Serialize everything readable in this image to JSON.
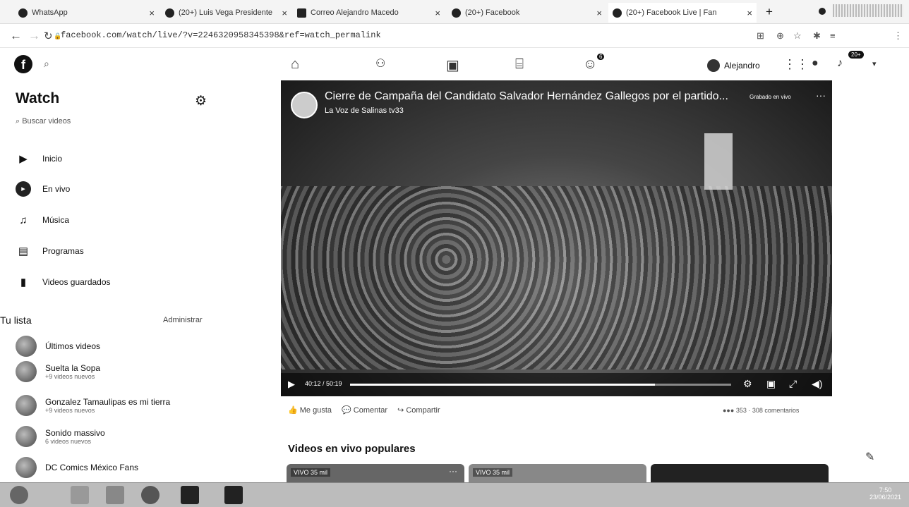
{
  "tabs": [
    {
      "title": "WhatsApp",
      "close": "×"
    },
    {
      "title": "(20+) Luis Vega Presidente",
      "close": "×"
    },
    {
      "title": "Correo Alejandro Macedo",
      "close": "×"
    },
    {
      "title": "(20+) Facebook",
      "close": "×"
    },
    {
      "title": "(20+) Facebook Live | Fan",
      "close": "×"
    }
  ],
  "new_tab": "+",
  "address": {
    "url": "facebook.com/watch/live/?v=2246320958345398&ref=watch_permalink"
  },
  "topnav": {
    "user": "Alejandro",
    "notif_count": "20+",
    "gaming_badge": "6"
  },
  "sidebar": {
    "title": "Watch",
    "search_placeholder": "Buscar videos",
    "items": [
      {
        "label": "Inicio"
      },
      {
        "label": "En vivo"
      },
      {
        "label": "Música"
      },
      {
        "label": "Programas"
      },
      {
        "label": "Videos guardados"
      }
    ],
    "list_title": "Tu lista",
    "manage": "Administrar",
    "list": [
      {
        "name": "Últimos videos",
        "sub": ""
      },
      {
        "name": "Suelta la Sopa",
        "sub": "+9 videos nuevos"
      },
      {
        "name": "Gonzalez Tamaulipas es mi tierra",
        "sub": "+9 videos nuevos"
      },
      {
        "name": "Sonido massivo",
        "sub": "6 videos nuevos"
      },
      {
        "name": "DC Comics México Fans",
        "sub": ""
      }
    ]
  },
  "video": {
    "title": "Cierre de Campaña del Candidato Salvador Hernández Gallegos por el partido...",
    "channel": "La Voz de Salinas tv33",
    "recorded": "Grabado en vivo",
    "more": "···",
    "time": "40:12 / 50:19",
    "progress": 0.8
  },
  "actions": {
    "like": "Me gusta",
    "comment": "Comentar",
    "share": "Compartir"
  },
  "reactions": {
    "summary": "353 · 308 comentarios"
  },
  "popular": {
    "title": "Videos en vivo populares",
    "cards": [
      {
        "badge": "VIVO  35 mil",
        "more": "···"
      },
      {
        "badge": "VIVO  35 mil",
        "more": ""
      },
      {
        "badge": "",
        "more": ""
      }
    ]
  },
  "taskbar": {
    "time": "7:50",
    "date": "23/06/2021"
  }
}
